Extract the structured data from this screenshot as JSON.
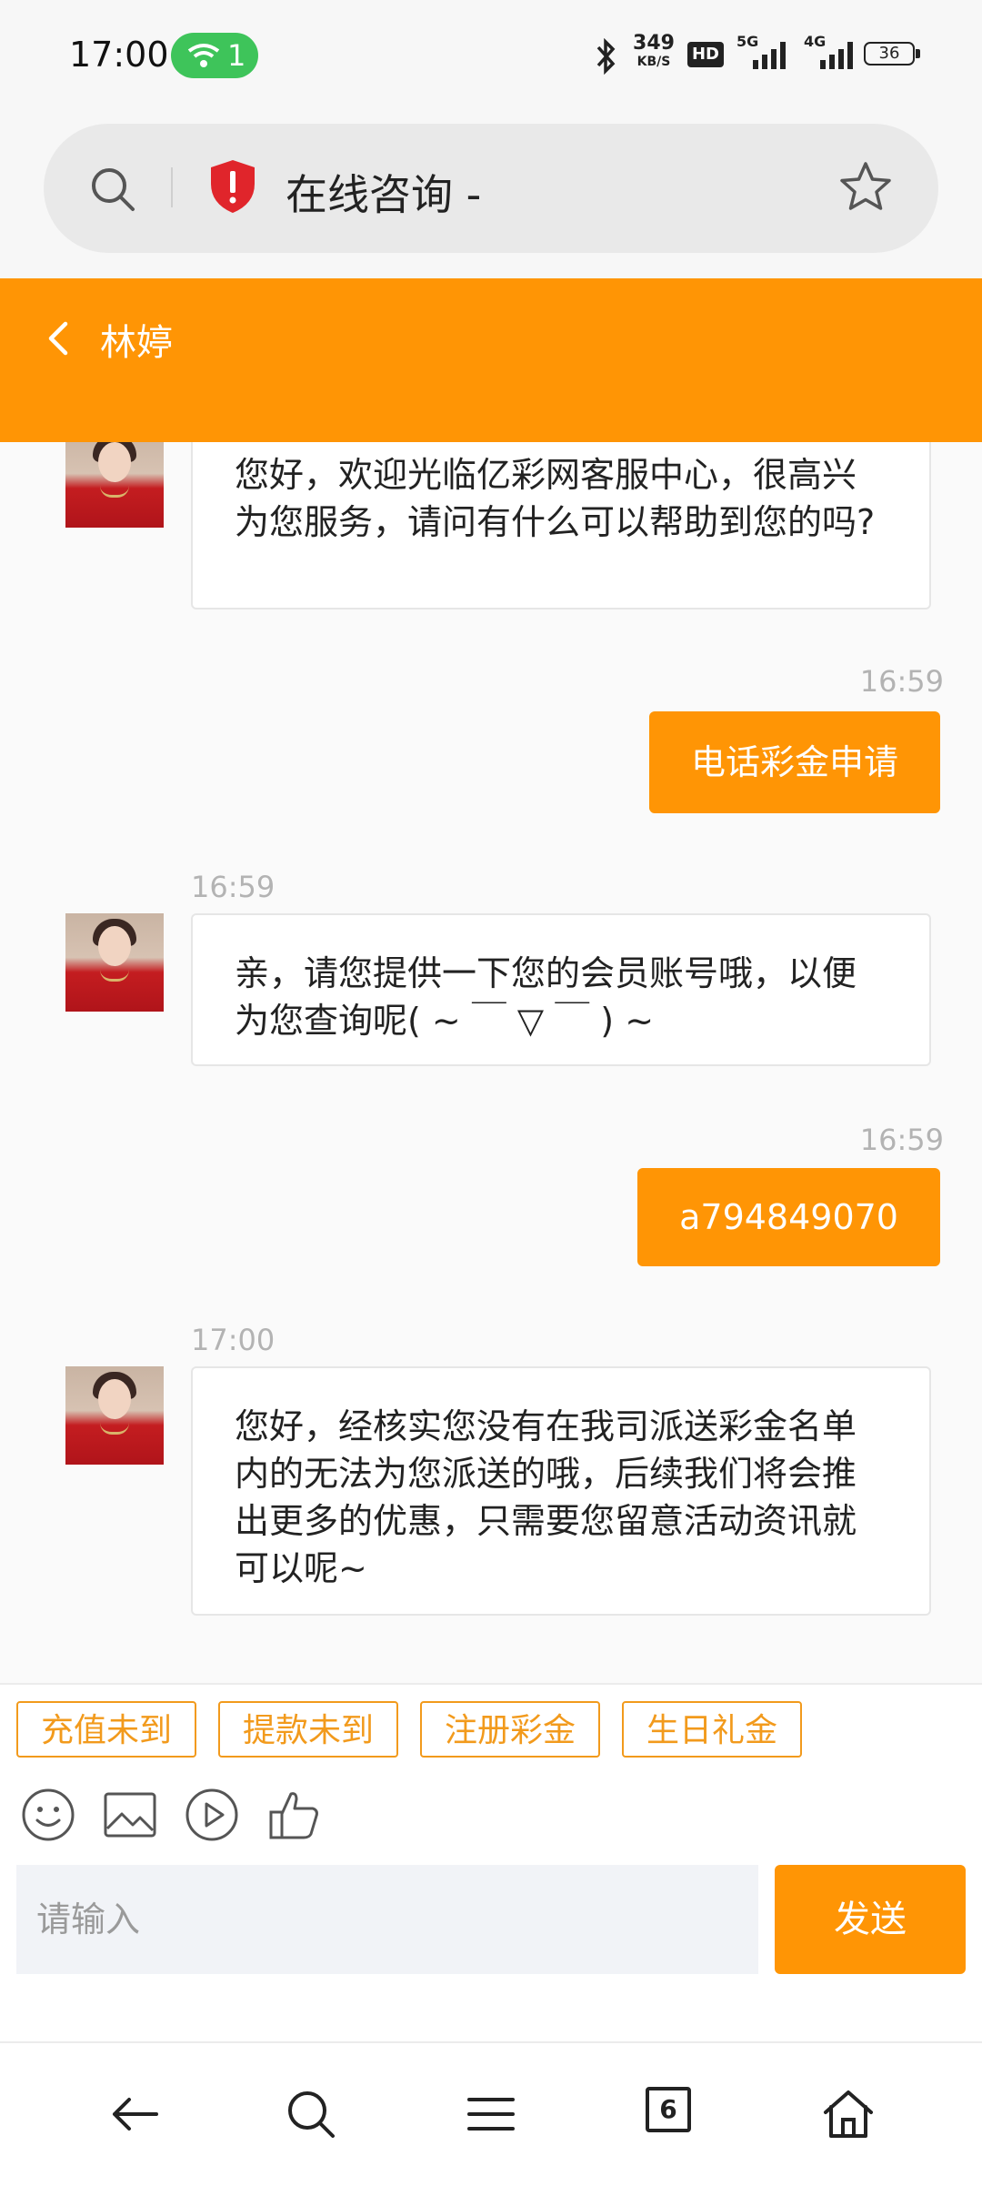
{
  "status_bar": {
    "time": "17:00",
    "hotspot_count": "1",
    "net_speed_value": "349",
    "net_speed_unit": "KB/S",
    "hd_label": "HD",
    "signal_5g_label": "5G",
    "signal_4g_label": "4G",
    "battery_level": "36",
    "icons": [
      "hotspot-icon",
      "bluetooth-icon",
      "hd-icon",
      "signal-5g-icon",
      "signal-4g-icon",
      "battery-icon"
    ]
  },
  "browser": {
    "page_title": "在线咨询 -",
    "icons": [
      "search-icon",
      "security-shield-icon",
      "star-icon"
    ]
  },
  "chat_header": {
    "agent_name": "林婷",
    "back_icon": "chevron-left-icon"
  },
  "messages": [
    {
      "from": "agent",
      "time": "",
      "text": "您好，欢迎光临亿彩网客服中心，很高兴为您服务，请问有什么可以帮助到您的吗?"
    },
    {
      "from": "user",
      "time": "16:59",
      "text": "电话彩金申请"
    },
    {
      "from": "agent",
      "time": "16:59",
      "text": "亲，请您提供一下您的会员账号哦，以便为您查询呢( ~ ￣ ▽ ￣ ) ~"
    },
    {
      "from": "user",
      "time": "16:59",
      "text": "a794849070"
    },
    {
      "from": "agent",
      "time": "17:00",
      "text": "您好，经核实您没有在我司派送彩金名单内的无法为您派送的哦，后续我们将会推出更多的优惠，只需要您留意活动资讯就可以呢~"
    }
  ],
  "quick_replies": [
    "充值未到",
    "提款未到",
    "注册彩金",
    "生日礼金"
  ],
  "toolbar_icons": [
    "emoji-icon",
    "image-icon",
    "video-icon",
    "thumbs-up-icon"
  ],
  "input": {
    "placeholder": "请输入",
    "value": "",
    "send_label": "发送"
  },
  "bottom_nav": {
    "tab_count": "6",
    "icons": [
      "back-arrow-icon",
      "search-icon",
      "menu-icon",
      "tabs-icon",
      "home-icon"
    ]
  },
  "colors": {
    "accent": "#ff9505",
    "quick_reply_border": "#f29a1c",
    "hotspot_green": "#3ec45a",
    "shield_red": "#e0252b"
  }
}
